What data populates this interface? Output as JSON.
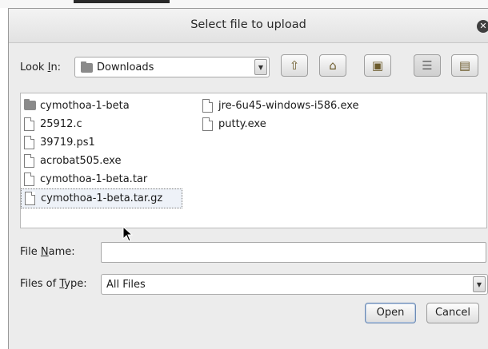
{
  "dialog": {
    "title": "Select file to upload"
  },
  "look_in": {
    "label_prefix": "Look ",
    "label_mnemonic": "I",
    "label_suffix": "n:",
    "value": "Downloads"
  },
  "toolbar": [
    {
      "icon": "up-folder-icon"
    },
    {
      "icon": "home-icon"
    },
    {
      "icon": "new-folder-icon"
    },
    {
      "icon": "list-view-icon",
      "toggled": true
    },
    {
      "icon": "details-view-icon"
    }
  ],
  "files": {
    "column1": [
      {
        "name": "cymothoa-1-beta",
        "type": "folder"
      },
      {
        "name": "25912.c",
        "type": "file"
      },
      {
        "name": "39719.ps1",
        "type": "file"
      },
      {
        "name": "acrobat505.exe",
        "type": "file"
      },
      {
        "name": "cymothoa-1-beta.tar",
        "type": "file"
      },
      {
        "name": "cymothoa-1-beta.tar.gz",
        "type": "file",
        "selected": true
      }
    ],
    "column2": [
      {
        "name": "jre-6u45-windows-i586.exe",
        "type": "file"
      },
      {
        "name": "putty.exe",
        "type": "file"
      }
    ]
  },
  "file_name": {
    "label_prefix": "File ",
    "label_mnemonic": "N",
    "label_suffix": "ame:",
    "value": ""
  },
  "file_type": {
    "label_prefix": "Files of ",
    "label_mnemonic": "T",
    "label_suffix": "ype:",
    "value": "All Files"
  },
  "buttons": {
    "open": "Open",
    "cancel": "Cancel"
  }
}
